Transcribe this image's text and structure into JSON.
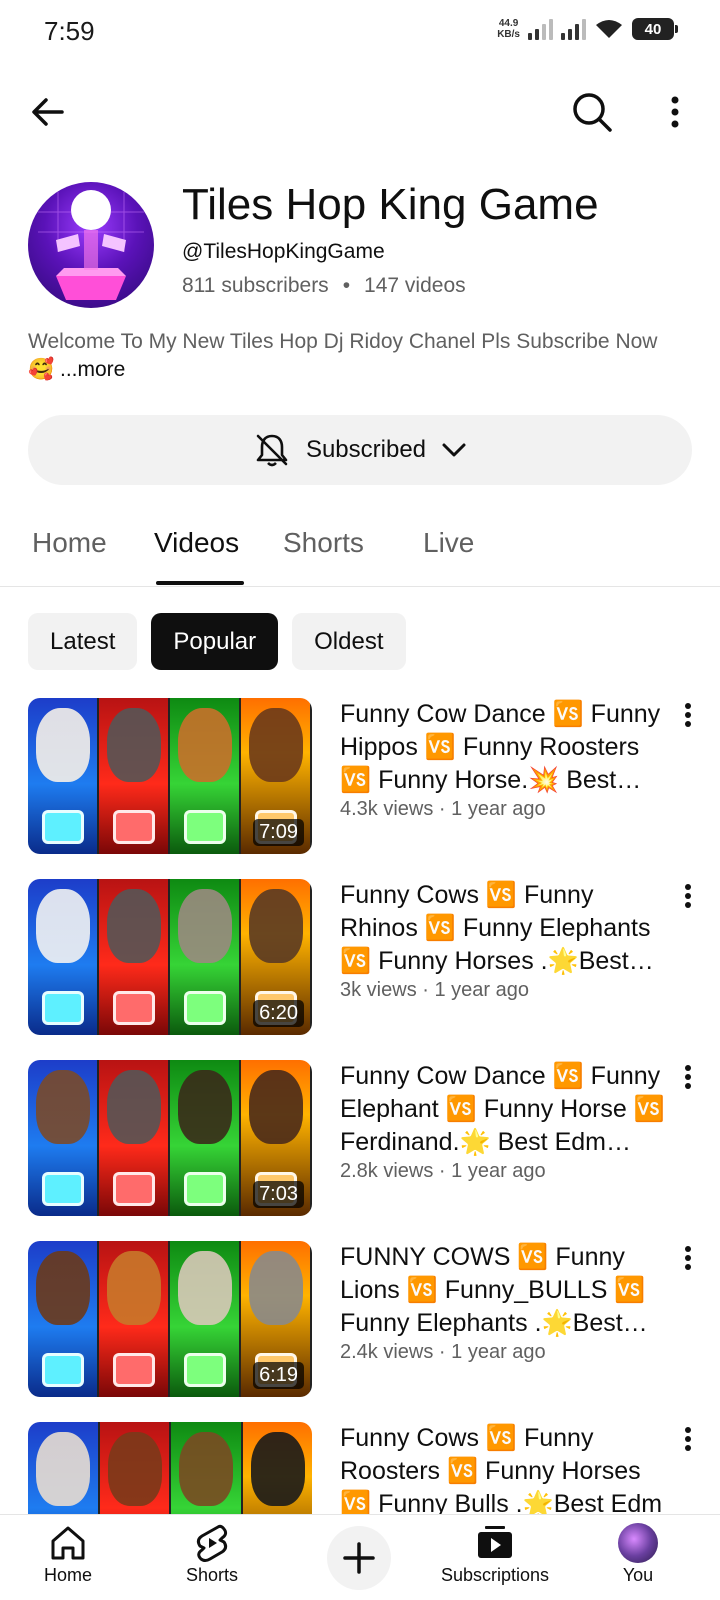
{
  "status_bar": {
    "time": "7:59",
    "net_speed_value": "44.9",
    "net_speed_unit": "KB/s",
    "battery": "40"
  },
  "channel": {
    "name": "Tiles Hop King Game",
    "handle": "@TilesHopKingGame",
    "subscribers": "811 subscribers",
    "separator": "•",
    "videos": "147 videos",
    "description": "Welcome To My New Tiles Hop Dj Ridoy Chanel Pls Subscribe Now 🥰",
    "more_label": "...more",
    "subscribe_label": "Subscribed"
  },
  "tabs": [
    {
      "label": "Home"
    },
    {
      "label": "Videos"
    },
    {
      "label": "Shorts"
    },
    {
      "label": "Live"
    }
  ],
  "active_tab": "Videos",
  "chips": [
    {
      "label": "Latest"
    },
    {
      "label": "Popular"
    },
    {
      "label": "Oldest"
    }
  ],
  "active_chip": "Popular",
  "videos": [
    {
      "title": "Funny Cow Dance 🆚 Funny Hippos 🆚  Funny Roosters 🆚 Funny Horse.💥 Best Edm Rush Tiles Hop",
      "meta": "4.3k views · 1 year ago",
      "duration": "7:09"
    },
    {
      "title": "Funny Cows 🆚 Funny Rhinos 🆚 Funny Elephants 🆚 Funny Horses .🌟Best Edm Rush Tiles Hop",
      "meta": "3k views · 1 year ago",
      "duration": "6:20"
    },
    {
      "title": "Funny Cow Dance 🆚 Funny Elephant 🆚 Funny Horse 🆚 Ferdinand.🌟 Best Edm Rush Tiles Hop",
      "meta": "2.8k views · 1 year ago",
      "duration": "7:03"
    },
    {
      "title": "FUNNY COWS 🆚 Funny Lions 🆚 Funny_BULLS 🆚 Funny Elephants .🌟Best Edm Rush Tiles Hop",
      "meta": "2.4k views · 1 year ago",
      "duration": "6:19"
    },
    {
      "title": "Funny Cows 🆚 Funny Roosters 🆚 Funny Horses 🆚 Funny Bulls .🌟Best Edm",
      "meta": "",
      "duration": ""
    }
  ],
  "bottom_nav": {
    "home": "Home",
    "shorts": "Shorts",
    "subscriptions": "Subscriptions",
    "you": "You"
  },
  "colors": {
    "text_primary": "#0f0f0f",
    "text_secondary": "#606060",
    "chip_bg": "#f2f2f2",
    "chip_active_bg": "#0f0f0f"
  },
  "icons": [
    "back-arrow-icon",
    "search-icon",
    "more-vert-icon",
    "bell-off-icon",
    "chevron-down-icon",
    "home-icon",
    "shorts-icon",
    "plus-icon",
    "subscriptions-icon"
  ]
}
